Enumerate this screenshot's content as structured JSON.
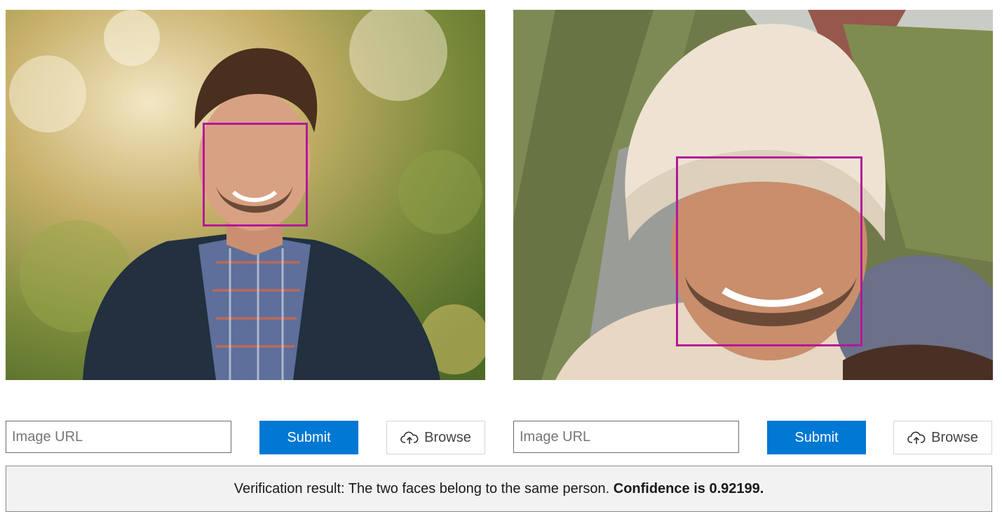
{
  "colors": {
    "accent": "#0078d4",
    "face_box": "#b4179a",
    "result_bg": "#f2f2f2"
  },
  "panels": [
    {
      "image_description": "man in navy jacket and plaid shirt outdoors",
      "url_placeholder": "Image URL",
      "submit_label": "Submit",
      "browse_label": "Browse",
      "browse_icon": "cloud-upload-icon"
    },
    {
      "image_description": "man in beige knit beanie smiling",
      "url_placeholder": "Image URL",
      "submit_label": "Submit",
      "browse_label": "Browse",
      "browse_icon": "cloud-upload-icon"
    }
  ],
  "result": {
    "text": "Verification result: The two faces belong to the same person. ",
    "confidence_text": "Confidence is 0.92199."
  }
}
